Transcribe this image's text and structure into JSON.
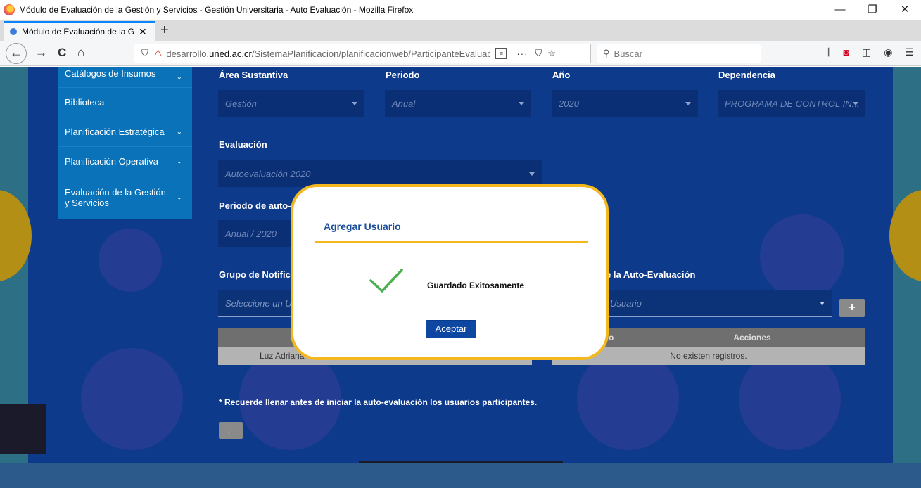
{
  "window": {
    "title": "Módulo de Evaluación de la Gestión y Servicios - Gestión Universitaria - Auto Evaluación - Mozilla Firefox",
    "minimize": "—",
    "restore": "❐",
    "close": "✕"
  },
  "tab": {
    "title": "Módulo de Evaluación de la Ge",
    "close": "✕",
    "new_tab": "+"
  },
  "nav": {
    "back": "←",
    "forward": "→",
    "reload": "C",
    "home": "⌂",
    "url_prefix": "desarrollo.",
    "url_domain": "uned.ac.cr",
    "url_path": "/SistemaPlanificacion/planificacionweb/ParticipanteEvaluacio",
    "more": "···",
    "search_placeholder": "Buscar"
  },
  "sidebar": {
    "items": [
      {
        "label": "Catálogos de Insumos"
      },
      {
        "label": "Biblioteca"
      },
      {
        "label": "Planificación Estratégica"
      },
      {
        "label": "Planificación Operativa"
      },
      {
        "label": "Evaluación de la Gestión y Servicios"
      }
    ]
  },
  "form": {
    "area_label": "Área Sustantiva",
    "area_value": "Gestión",
    "periodo_label": "Periodo",
    "periodo_value": "Anual",
    "anio_label": "Año",
    "anio_value": "2020",
    "dependencia_label": "Dependencia",
    "dependencia_value": "PROGRAMA DE CONTROL IN...",
    "evaluacion_label": "Evaluación",
    "evaluacion_value": "Autoevaluación 2020",
    "periodo_auto_label": "Periodo de auto-ev",
    "periodo_auto_value": "Anual / 2020",
    "grupo_label": "Grupo de Notificac",
    "grupo_placeholder": "Seleccione un Us",
    "participantes_label": "e la Auto-Evaluación",
    "participantes_placeholder": "Usuario",
    "add_button": "+",
    "left_table_row": "Luz Adriana",
    "right_table_col1": "o",
    "right_table_col2": "Acciones",
    "right_table_empty": "No existen registros.",
    "note": "* Recuerde llenar antes de iniciar la auto-evaluación los usuarios participantes.",
    "back_button": "←"
  },
  "modal": {
    "title": "Agregar Usuario",
    "message": "Guardado Exitosamente",
    "accept": "Aceptar",
    "accent_color": "#f3b81e",
    "check_color": "#4caf50"
  }
}
